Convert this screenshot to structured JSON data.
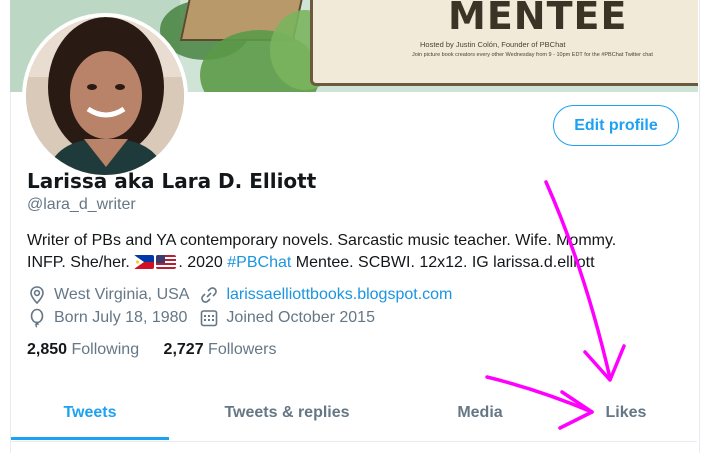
{
  "banner": {
    "title": "MENTEE",
    "host_line": "Hosted by Justin Colón, Founder of PBChat",
    "sub_line": "Join picture book creators every other Wednesday from 9 - 10pm EDT for the #PBChat Twitter chat"
  },
  "profile": {
    "edit_button": "Edit profile",
    "display_name": "Larissa aka Lara D. Elliott",
    "handle": "@lara_d_writer",
    "bio_line1": "Writer of PBs and YA contemporary novels. Sarcastic music teacher. Wife. Mommy.",
    "bio_line2_prefix": "INFP. She/her.",
    "bio_line2_mid": ". 2020",
    "bio_hashtag": "#PBChat",
    "bio_line2_suffix": "Mentee. SCBWI. 12x12. IG larissa.d.elliott",
    "location": "West Virginia, USA",
    "website": "larissaelliottbooks.blogspot.com",
    "birthday": "Born July 18, 1980",
    "joined": "Joined October 2015",
    "following_count": "2,850",
    "following_label": "Following",
    "followers_count": "2,727",
    "followers_label": "Followers"
  },
  "tabs": [
    {
      "label": "Tweets",
      "active": true
    },
    {
      "label": "Tweets & replies",
      "active": false
    },
    {
      "label": "Media",
      "active": false
    },
    {
      "label": "Likes",
      "active": false
    }
  ],
  "icons": {
    "location": "location-pin-icon",
    "link": "link-icon",
    "birthday": "balloon-icon",
    "joined": "calendar-icon"
  },
  "colors": {
    "accent": "#1da1f2",
    "link": "#1b95e0",
    "annotation": "#ff00ff",
    "muted": "#657786"
  }
}
